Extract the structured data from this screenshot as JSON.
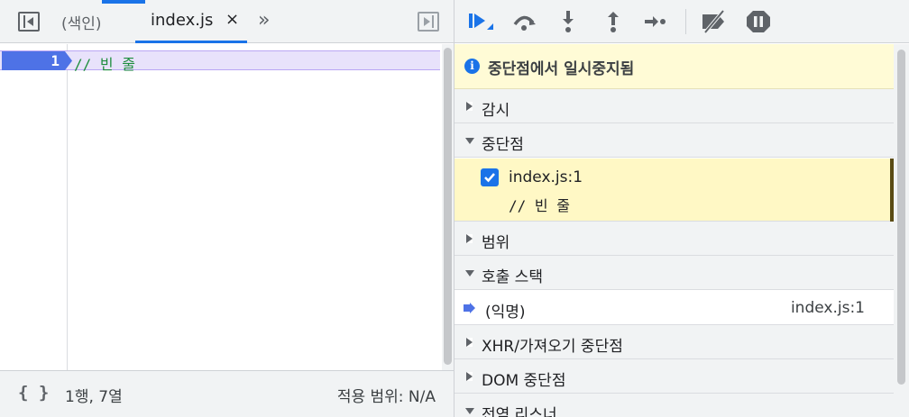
{
  "editor": {
    "tabs": {
      "navigator_icon": "navigator-toggle-icon",
      "index_label": "(색인)",
      "file_label": "index.js",
      "close_glyph": "×",
      "more_glyph": "»",
      "debugger_icon": "debugger-toggle-icon"
    },
    "lines": [
      {
        "number": "1",
        "code": "// 빈 줄",
        "paused": true
      }
    ],
    "status": {
      "pretty_print_label": "{ }",
      "position": "1행, 7열",
      "coverage": "적용 범위: N/A"
    }
  },
  "debugger": {
    "toolbar": {
      "resume": "resume-icon",
      "step_over": "step-over-icon",
      "step_into": "step-into-icon",
      "step_out": "step-out-icon",
      "step": "step-icon",
      "deactivate": "deactivate-breakpoints-icon",
      "pause_on_exceptions": "pause-on-exceptions-icon"
    },
    "paused_message": "중단점에서 일시중지됨",
    "sections": {
      "watch": "감시",
      "breakpoints": "중단점",
      "scope": "범위",
      "call_stack": "호출 스택",
      "xhr": "XHR/가져오기 중단점",
      "dom": "DOM 중단점",
      "listeners": "전역 리스너"
    },
    "breakpoint": {
      "checked": true,
      "location": "index.js:1",
      "snippet": "// 빈 줄"
    },
    "call_frame": {
      "name": "(익명)",
      "location": "index.js:1"
    }
  },
  "colors": {
    "accent": "#1a73e8",
    "paused_banner": "#fffbd6",
    "breakpoint_row": "#fff8c5",
    "exec_line": "#e8e2fb",
    "code_comment": "#1e8e3e"
  }
}
